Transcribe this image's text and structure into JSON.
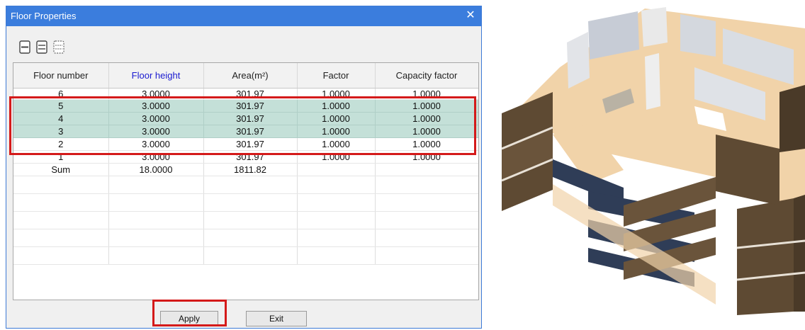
{
  "dialog": {
    "title": "Floor Properties",
    "close_glyph": "✕",
    "toolbar": {
      "icons": [
        "insert-floor-icon",
        "split-floor-icon",
        "merge-floor-icon"
      ]
    },
    "table": {
      "columns": [
        "Floor number",
        "Floor height",
        "Area(m²)",
        "Factor",
        "Capacity factor"
      ],
      "rows": [
        [
          "6",
          "3.0000",
          "301.97",
          "1.0000",
          "1.0000"
        ],
        [
          "5",
          "3.0000",
          "301.97",
          "1.0000",
          "1.0000"
        ],
        [
          "4",
          "3.0000",
          "301.97",
          "1.0000",
          "1.0000"
        ],
        [
          "3",
          "3.0000",
          "301.97",
          "1.0000",
          "1.0000"
        ],
        [
          "2",
          "3.0000",
          "301.97",
          "1.0000",
          "1.0000"
        ],
        [
          "1",
          "3.0000",
          "301.97",
          "1.0000",
          "1.0000"
        ],
        [
          "Sum",
          "18.0000",
          "1811.82",
          "",
          ""
        ]
      ],
      "selected_floors": [
        "5",
        "4",
        "3"
      ]
    },
    "buttons": {
      "apply": "Apply",
      "exit": "Exit"
    }
  },
  "colors": {
    "titlebar": "#3b7ddd",
    "selection": "#c4e0d8",
    "highlight": "#d41a1a",
    "header_highlight_text": "#1a1ad0"
  }
}
